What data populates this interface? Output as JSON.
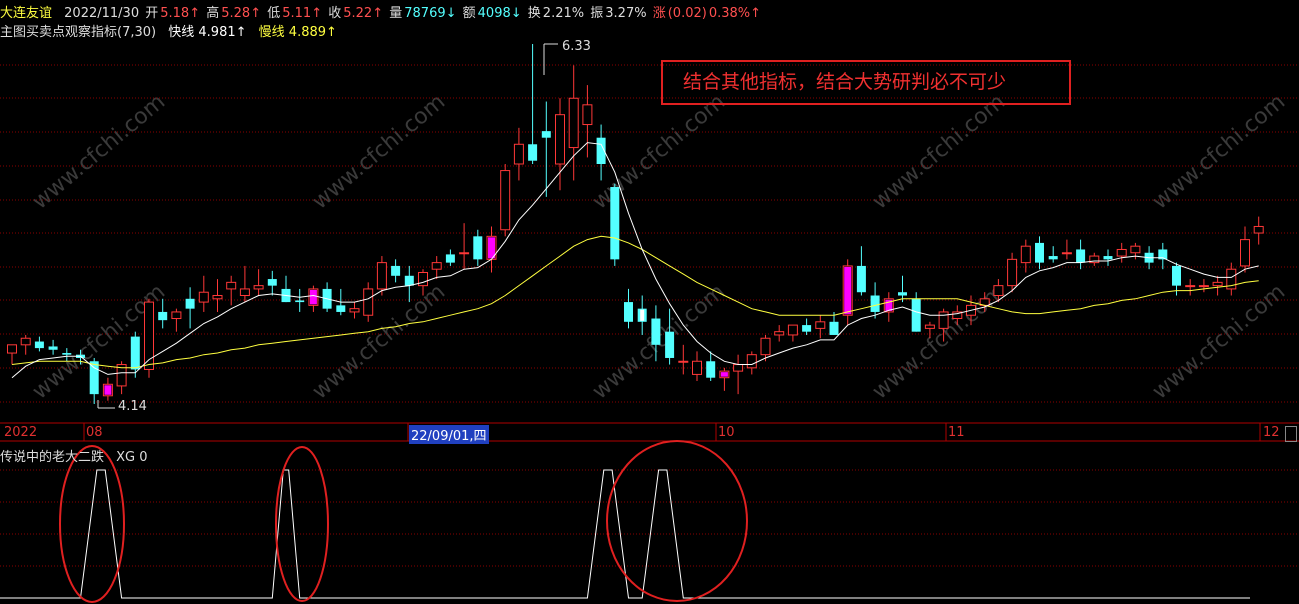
{
  "header": {
    "stock_name": "大连友谊",
    "date": "2022/11/30",
    "open_label": "开",
    "open_value": "5.18↑",
    "high_label": "高",
    "high_value": "5.28↑",
    "low_label": "低",
    "low_value": "5.11↑",
    "close_label": "收",
    "close_value": "5.22↑",
    "volume_label": "量",
    "volume_value": "78769↓",
    "amount_label": "额",
    "amount_value": "4098↓",
    "turnover_label": "换",
    "turnover_value": "2.21%",
    "amplitude_label": "振",
    "amplitude_value": "3.27%",
    "change_label": "涨",
    "change_value": "(0.02)",
    "change_pct": "0.38%↑"
  },
  "indicator": {
    "name": "主图买卖点观察指标(7,30)",
    "fast_label": "快线",
    "fast_value": "4.981↑",
    "slow_label": "慢线",
    "slow_value": "4.889↑"
  },
  "annotation": "结合其他指标，结合大势研判必不可少",
  "max_label": "6.33",
  "min_label": "4.14",
  "date_axis": {
    "y2022": "2022",
    "m08": "08",
    "selected": "22/09/01,四",
    "m10": "10",
    "m11": "11",
    "m12": "12"
  },
  "sub_indicator": {
    "name": "传说中的老大二跌",
    "xg_label": "XG",
    "xg_value": "0"
  },
  "watermark": "www.cfchi.com",
  "colors": {
    "up": "#ff3838",
    "down": "#54ffff",
    "marker": "#ff00ff",
    "fast_line": "#ffffff",
    "slow_line": "#ffff40",
    "grid": "#8a0000",
    "annotation": "#e02020"
  },
  "chart_data": {
    "type": "candlestick",
    "ylim": [
      4.0,
      6.5
    ],
    "candles": [
      {
        "o": 4.45,
        "h": 4.5,
        "l": 4.38,
        "c": 4.5
      },
      {
        "o": 4.5,
        "h": 4.56,
        "l": 4.44,
        "c": 4.54
      },
      {
        "o": 4.52,
        "h": 4.55,
        "l": 4.46,
        "c": 4.48
      },
      {
        "o": 4.49,
        "h": 4.53,
        "l": 4.44,
        "c": 4.47
      },
      {
        "o": 4.45,
        "h": 4.48,
        "l": 4.4,
        "c": 4.44
      },
      {
        "o": 4.44,
        "h": 4.47,
        "l": 4.38,
        "c": 4.42
      },
      {
        "o": 4.4,
        "h": 4.42,
        "l": 4.14,
        "c": 4.2
      },
      {
        "o": 4.19,
        "h": 4.3,
        "l": 4.16,
        "c": 4.26,
        "mark": true
      },
      {
        "o": 4.25,
        "h": 4.4,
        "l": 4.2,
        "c": 4.38
      },
      {
        "o": 4.55,
        "h": 4.58,
        "l": 4.3,
        "c": 4.35
      },
      {
        "o": 4.35,
        "h": 4.78,
        "l": 4.3,
        "c": 4.76
      },
      {
        "o": 4.7,
        "h": 4.78,
        "l": 4.6,
        "c": 4.65
      },
      {
        "o": 4.66,
        "h": 4.72,
        "l": 4.58,
        "c": 4.7
      },
      {
        "o": 4.78,
        "h": 4.85,
        "l": 4.6,
        "c": 4.72
      },
      {
        "o": 4.76,
        "h": 4.92,
        "l": 4.7,
        "c": 4.82
      },
      {
        "o": 4.78,
        "h": 4.9,
        "l": 4.7,
        "c": 4.8
      },
      {
        "o": 4.84,
        "h": 4.92,
        "l": 4.74,
        "c": 4.88
      },
      {
        "o": 4.8,
        "h": 4.98,
        "l": 4.76,
        "c": 4.84
      },
      {
        "o": 4.84,
        "h": 4.96,
        "l": 4.8,
        "c": 4.86
      },
      {
        "o": 4.9,
        "h": 4.95,
        "l": 4.8,
        "c": 4.86
      },
      {
        "o": 4.84,
        "h": 4.92,
        "l": 4.76,
        "c": 4.76
      },
      {
        "o": 4.77,
        "h": 4.84,
        "l": 4.7,
        "c": 4.76
      },
      {
        "o": 4.74,
        "h": 4.86,
        "l": 4.7,
        "c": 4.84,
        "mark": true
      },
      {
        "o": 4.84,
        "h": 4.88,
        "l": 4.7,
        "c": 4.72
      },
      {
        "o": 4.74,
        "h": 4.84,
        "l": 4.68,
        "c": 4.7
      },
      {
        "o": 4.7,
        "h": 4.76,
        "l": 4.66,
        "c": 4.72
      },
      {
        "o": 4.68,
        "h": 4.88,
        "l": 4.64,
        "c": 4.84
      },
      {
        "o": 4.84,
        "h": 5.04,
        "l": 4.8,
        "c": 5.0
      },
      {
        "o": 4.98,
        "h": 5.02,
        "l": 4.88,
        "c": 4.92
      },
      {
        "o": 4.92,
        "h": 4.98,
        "l": 4.76,
        "c": 4.86
      },
      {
        "o": 4.86,
        "h": 4.96,
        "l": 4.8,
        "c": 4.94
      },
      {
        "o": 4.96,
        "h": 5.04,
        "l": 4.9,
        "c": 5.0
      },
      {
        "o": 5.05,
        "h": 5.08,
        "l": 4.98,
        "c": 5.0
      },
      {
        "o": 5.06,
        "h": 5.24,
        "l": 4.96,
        "c": 5.06
      },
      {
        "o": 5.16,
        "h": 5.2,
        "l": 4.98,
        "c": 5.02
      },
      {
        "o": 5.02,
        "h": 5.22,
        "l": 4.94,
        "c": 5.16,
        "mark": true
      },
      {
        "o": 5.2,
        "h": 5.6,
        "l": 5.16,
        "c": 5.56
      },
      {
        "o": 5.6,
        "h": 5.82,
        "l": 5.5,
        "c": 5.72
      },
      {
        "o": 5.72,
        "h": 6.33,
        "l": 5.6,
        "c": 5.62
      },
      {
        "o": 5.8,
        "h": 5.98,
        "l": 5.4,
        "c": 5.76
      },
      {
        "o": 5.6,
        "h": 6.0,
        "l": 5.44,
        "c": 5.9
      },
      {
        "o": 5.7,
        "h": 6.2,
        "l": 5.5,
        "c": 6.0
      },
      {
        "o": 5.84,
        "h": 6.08,
        "l": 5.64,
        "c": 5.96
      },
      {
        "o": 5.76,
        "h": 5.84,
        "l": 5.5,
        "c": 5.6
      },
      {
        "o": 5.46,
        "h": 5.48,
        "l": 4.98,
        "c": 5.02
      },
      {
        "o": 4.76,
        "h": 4.84,
        "l": 4.6,
        "c": 4.64
      },
      {
        "o": 4.72,
        "h": 4.8,
        "l": 4.56,
        "c": 4.64,
        "mark": true
      },
      {
        "o": 4.66,
        "h": 4.74,
        "l": 4.4,
        "c": 4.5
      },
      {
        "o": 4.58,
        "h": 4.72,
        "l": 4.38,
        "c": 4.42
      },
      {
        "o": 4.4,
        "h": 4.5,
        "l": 4.32,
        "c": 4.4
      },
      {
        "o": 4.32,
        "h": 4.46,
        "l": 4.28,
        "c": 4.4
      },
      {
        "o": 4.4,
        "h": 4.46,
        "l": 4.28,
        "c": 4.3
      },
      {
        "o": 4.3,
        "h": 4.36,
        "l": 4.22,
        "c": 4.34,
        "mark": true
      },
      {
        "o": 4.34,
        "h": 4.44,
        "l": 4.2,
        "c": 4.38
      },
      {
        "o": 4.36,
        "h": 4.46,
        "l": 4.32,
        "c": 4.44
      },
      {
        "o": 4.44,
        "h": 4.56,
        "l": 4.4,
        "c": 4.54
      },
      {
        "o": 4.56,
        "h": 4.62,
        "l": 4.52,
        "c": 4.58
      },
      {
        "o": 4.56,
        "h": 4.62,
        "l": 4.52,
        "c": 4.62
      },
      {
        "o": 4.62,
        "h": 4.66,
        "l": 4.56,
        "c": 4.58
      },
      {
        "o": 4.6,
        "h": 4.68,
        "l": 4.54,
        "c": 4.64
      },
      {
        "o": 4.64,
        "h": 4.7,
        "l": 4.56,
        "c": 4.56
      },
      {
        "o": 4.68,
        "h": 5.02,
        "l": 4.62,
        "c": 4.98,
        "mark": true
      },
      {
        "o": 4.98,
        "h": 5.1,
        "l": 4.8,
        "c": 4.82
      },
      {
        "o": 4.8,
        "h": 4.88,
        "l": 4.66,
        "c": 4.7
      },
      {
        "o": 4.7,
        "h": 4.82,
        "l": 4.64,
        "c": 4.78,
        "mark": true
      },
      {
        "o": 4.82,
        "h": 4.92,
        "l": 4.76,
        "c": 4.8
      },
      {
        "o": 4.78,
        "h": 4.82,
        "l": 4.58,
        "c": 4.58
      },
      {
        "o": 4.6,
        "h": 4.64,
        "l": 4.54,
        "c": 4.62
      },
      {
        "o": 4.6,
        "h": 4.72,
        "l": 4.52,
        "c": 4.7
      },
      {
        "o": 4.66,
        "h": 4.74,
        "l": 4.62,
        "c": 4.7
      },
      {
        "o": 4.68,
        "h": 4.8,
        "l": 4.62,
        "c": 4.74
      },
      {
        "o": 4.74,
        "h": 4.82,
        "l": 4.7,
        "c": 4.78
      },
      {
        "o": 4.8,
        "h": 4.9,
        "l": 4.76,
        "c": 4.86
      },
      {
        "o": 4.86,
        "h": 5.06,
        "l": 4.82,
        "c": 5.02
      },
      {
        "o": 5.0,
        "h": 5.14,
        "l": 4.94,
        "c": 5.1
      },
      {
        "o": 5.12,
        "h": 5.16,
        "l": 4.96,
        "c": 5.0
      },
      {
        "o": 5.04,
        "h": 5.1,
        "l": 5.0,
        "c": 5.02
      },
      {
        "o": 5.06,
        "h": 5.14,
        "l": 5.02,
        "c": 5.06
      },
      {
        "o": 5.08,
        "h": 5.14,
        "l": 4.96,
        "c": 5.0
      },
      {
        "o": 5.0,
        "h": 5.06,
        "l": 4.98,
        "c": 5.04
      },
      {
        "o": 5.04,
        "h": 5.08,
        "l": 4.98,
        "c": 5.02
      },
      {
        "o": 5.04,
        "h": 5.12,
        "l": 5.0,
        "c": 5.08
      },
      {
        "o": 5.06,
        "h": 5.12,
        "l": 5.02,
        "c": 5.1
      },
      {
        "o": 5.06,
        "h": 5.1,
        "l": 4.96,
        "c": 5.0
      },
      {
        "o": 5.08,
        "h": 5.12,
        "l": 4.96,
        "c": 5.02
      },
      {
        "o": 4.98,
        "h": 5.0,
        "l": 4.8,
        "c": 4.86
      },
      {
        "o": 4.86,
        "h": 4.9,
        "l": 4.8,
        "c": 4.86
      },
      {
        "o": 4.86,
        "h": 4.9,
        "l": 4.82,
        "c": 4.86
      },
      {
        "o": 4.86,
        "h": 4.92,
        "l": 4.8,
        "c": 4.88
      },
      {
        "o": 4.84,
        "h": 5.0,
        "l": 4.8,
        "c": 4.96
      },
      {
        "o": 4.98,
        "h": 5.22,
        "l": 4.94,
        "c": 5.14
      },
      {
        "o": 5.18,
        "h": 5.28,
        "l": 5.11,
        "c": 5.22
      }
    ],
    "fast_line": [
      4.3,
      4.37,
      4.41,
      4.42,
      4.43,
      4.43,
      4.36,
      4.32,
      4.33,
      4.33,
      4.41,
      4.46,
      4.51,
      4.57,
      4.63,
      4.67,
      4.72,
      4.76,
      4.8,
      4.81,
      4.8,
      4.79,
      4.8,
      4.78,
      4.76,
      4.76,
      4.78,
      4.83,
      4.85,
      4.86,
      4.88,
      4.91,
      4.92,
      4.96,
      4.97,
      5.02,
      5.13,
      5.26,
      5.35,
      5.45,
      5.55,
      5.65,
      5.73,
      5.72,
      5.55,
      5.3,
      5.08,
      4.9,
      4.75,
      4.62,
      4.52,
      4.45,
      4.4,
      4.38,
      4.38,
      4.42,
      4.45,
      4.48,
      4.5,
      4.53,
      4.53,
      4.62,
      4.66,
      4.68,
      4.71,
      4.73,
      4.7,
      4.68,
      4.68,
      4.69,
      4.71,
      4.73,
      4.77,
      4.83,
      4.91,
      4.95,
      4.97,
      5.0,
      5.0,
      5.01,
      5.01,
      5.03,
      5.04,
      5.03,
      5.03,
      4.99,
      4.96,
      4.93,
      4.91,
      4.91,
      4.96,
      4.98
    ],
    "slow_line": [
      4.38,
      4.39,
      4.4,
      4.4,
      4.4,
      4.4,
      4.38,
      4.37,
      4.36,
      4.36,
      4.38,
      4.39,
      4.41,
      4.42,
      4.44,
      4.45,
      4.47,
      4.48,
      4.5,
      4.51,
      4.52,
      4.53,
      4.54,
      4.55,
      4.56,
      4.57,
      4.58,
      4.6,
      4.61,
      4.63,
      4.64,
      4.66,
      4.68,
      4.7,
      4.72,
      4.75,
      4.8,
      4.86,
      4.92,
      4.98,
      5.04,
      5.1,
      5.14,
      5.16,
      5.15,
      5.12,
      5.08,
      5.03,
      4.98,
      4.93,
      4.88,
      4.84,
      4.8,
      4.76,
      4.72,
      4.7,
      4.68,
      4.68,
      4.68,
      4.68,
      4.68,
      4.7,
      4.72,
      4.74,
      4.76,
      4.78,
      4.78,
      4.78,
      4.78,
      4.78,
      4.76,
      4.74,
      4.72,
      4.7,
      4.69,
      4.69,
      4.7,
      4.71,
      4.72,
      4.74,
      4.75,
      4.77,
      4.78,
      4.8,
      4.82,
      4.83,
      4.83,
      4.84,
      4.85,
      4.86,
      4.88,
      4.89
    ],
    "sub_signal": [
      {
        "from": 5,
        "to": 8
      },
      {
        "from": 19,
        "to": 21
      },
      {
        "from": 42,
        "to": 45
      },
      {
        "from": 46,
        "to": 49
      }
    ]
  }
}
